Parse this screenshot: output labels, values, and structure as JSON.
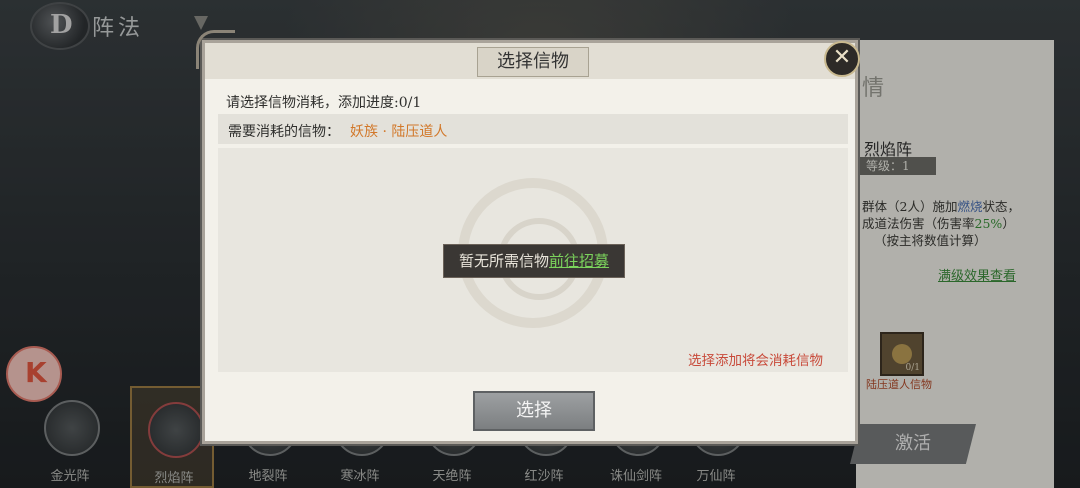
{
  "topbar": {
    "title": "阵法"
  },
  "logo": {
    "char": "D"
  },
  "dialog": {
    "title": "选择信物",
    "close_label": "✕",
    "progress": "请选择信物消耗，添加进度:0/1",
    "need_label": "需要消耗的信物：",
    "need_value": "妖族 · 陆压道人",
    "empty_text": "暂无所需信物",
    "empty_link": "前往招募",
    "warning": "选择添加将会消耗信物",
    "select_button": "选择"
  },
  "right_panel": {
    "header": "情",
    "formation_name": "烈焰阵",
    "level": "等级：1",
    "desc_line1_a": "群体（2人）施加",
    "desc_kw": "燃烧",
    "desc_line1_b": "状态，",
    "desc_line2_a": "成道法伤害（伤害率",
    "desc_pct": "25%",
    "desc_line2_b": "）",
    "desc_line3": "（按主将数值计算）",
    "max_link": "满级效果查看",
    "item_count": "0/1",
    "item_label": "陆压道人信物",
    "activate": "激活"
  },
  "formations": [
    {
      "name": "金光阵"
    },
    {
      "name": "烈焰阵"
    },
    {
      "name": "地裂阵"
    },
    {
      "name": "寒冰阵"
    },
    {
      "name": "天绝阵"
    },
    {
      "name": "红沙阵"
    },
    {
      "name": "诛仙剑阵"
    },
    {
      "name": "万仙阵"
    }
  ],
  "colors": {
    "accent_orange": "#d2782a",
    "link_green": "#7bd35c",
    "warning_red": "#c84a3a"
  }
}
